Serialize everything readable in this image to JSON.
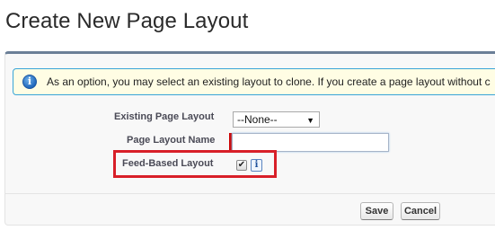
{
  "page": {
    "title": "Create New Page Layout"
  },
  "info": {
    "icon": "info-icon",
    "icon_glyph": "i",
    "message": "As an option, you may select an existing layout to clone. If you create a page layout without c"
  },
  "form": {
    "existing_layout": {
      "label": "Existing Page Layout",
      "selected": "--None--",
      "arrow": "▼"
    },
    "layout_name": {
      "label": "Page Layout Name",
      "value": "",
      "required": true
    },
    "feed_based": {
      "label": "Feed-Based Layout",
      "checked": true,
      "check_glyph": "✔",
      "help_glyph": "i"
    }
  },
  "buttons": {
    "save": "Save",
    "cancel": "Cancel"
  },
  "colors": {
    "highlight": "#d81f28",
    "info_border": "#39a5d8",
    "info_background": "#fffde4",
    "panel_top_border": "#6b7f97",
    "required_marker": "#cc0000"
  }
}
